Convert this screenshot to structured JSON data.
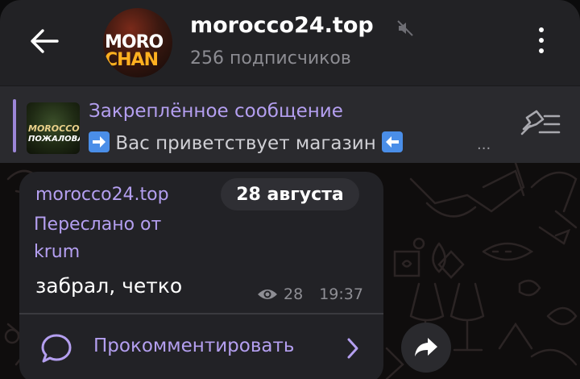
{
  "header": {
    "title": "morocco24.top",
    "subtitle": "256 подписчиков",
    "avatar_line1": "MORO",
    "avatar_line2": "CHAN",
    "back_icon": "arrow-left-icon",
    "mute_icon": "muted-speaker-icon",
    "menu_icon": "kebab-menu-icon"
  },
  "pinned": {
    "title": "Закреплённое сообщение",
    "text": "Вас приветствует магазин",
    "ellipsis": "...",
    "thumb_line1": "MOROCCO",
    "thumb_line2": "ПОЖАЛОВАТЬ",
    "unpin_icon": "unpin-list-icon"
  },
  "message": {
    "channel": "morocco24.top",
    "date": "28 августа",
    "forwarded_label": "Переслано от krum",
    "text": "забрал, четко",
    "views": "28",
    "time": "19:37",
    "comment_label": "Прокомментировать",
    "share_icon": "share-arrow-icon"
  },
  "colors": {
    "accent": "#b49ff0",
    "header_bg": "#222225",
    "bubble_bg": "#222226",
    "pinned_bg": "#2a2a2e"
  }
}
